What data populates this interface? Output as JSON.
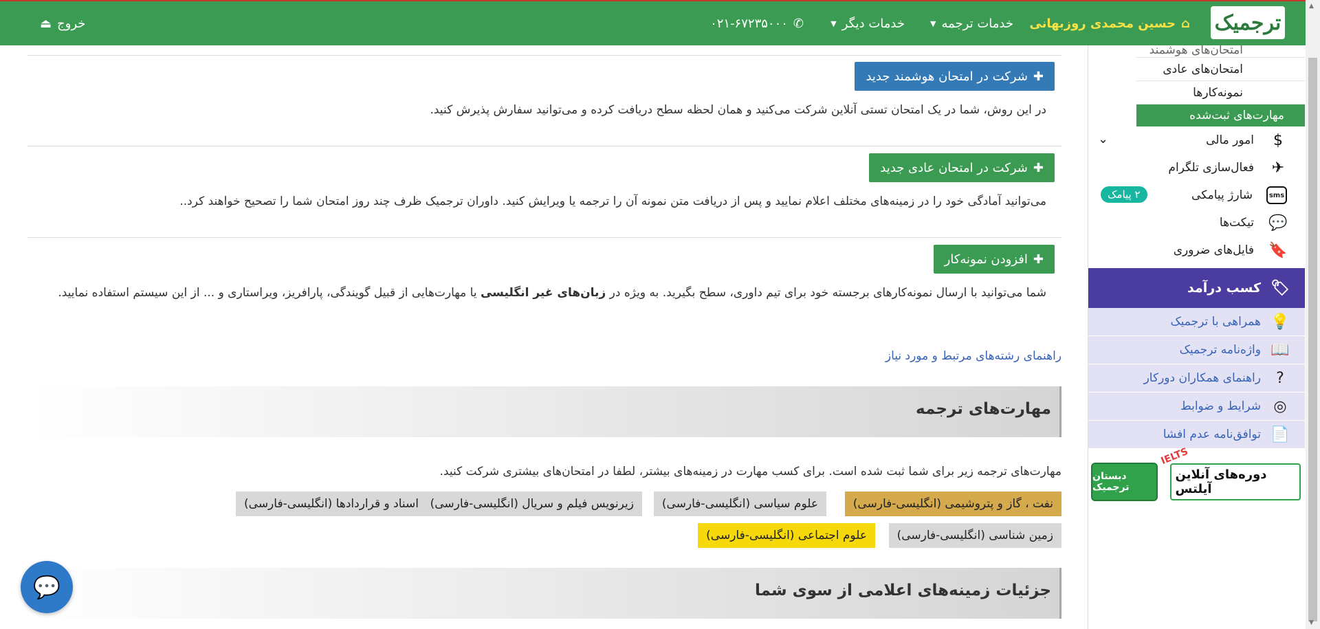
{
  "navbar": {
    "brand": "ترجمیک",
    "user": "حسین محمدی روزبهانی",
    "services": "خدمات ترجمه",
    "other_services": "خدمات دیگر",
    "phone": "۰۲۱-۶۷۲۳۵۰۰۰",
    "logout": "خروج"
  },
  "sidebar": {
    "sub_items": [
      {
        "label": "امتحان‌های هوشمند"
      },
      {
        "label": "امتحان‌های عادی"
      },
      {
        "label": "نمونه‌کارها"
      },
      {
        "label": "مهارت‌های ثبت‌شده"
      }
    ],
    "menu": [
      {
        "label": "امور مالی",
        "icon": "dollar-icon"
      },
      {
        "label": "فعال‌سازی تلگرام",
        "icon": "paper-plane-icon"
      },
      {
        "label": "شارژ پیامکی",
        "icon": "sms-icon",
        "icon_text": "sms",
        "badge": "۲ پیامک"
      },
      {
        "label": "تیکت‌ها",
        "icon": "chat-bubbles-icon"
      },
      {
        "label": "فایل‌های ضروری",
        "icon": "bookmark-icon"
      }
    ],
    "income_header": "کسب درآمد",
    "income_items": [
      {
        "label": "همراهی با ترجمیک",
        "icon": "lightbulb-icon"
      },
      {
        "label": "واژه‌نامه ترجمیک",
        "icon": "dictionary-icon"
      },
      {
        "label": "راهنمای همکاران دورکار",
        "icon": "question-icon"
      },
      {
        "label": "شرایط و ضوابط",
        "icon": "fingerprint-icon"
      },
      {
        "label": "توافق‌نامه عدم افشا",
        "icon": "document-icon"
      }
    ],
    "banner": {
      "logo_text": "دبستان ترجمیک",
      "text": "دوره‌های آنلاین آیلتس",
      "tag": "IELTS"
    }
  },
  "main": {
    "smart_exam_button": "شرکت در امتحان هوشمند جدید",
    "smart_exam_desc": "در این روش، شما در یک امتحان تستی آنلاین شرکت می‌کنید و همان لحظه سطح دریافت کرده و می‌توانید سفارش پذیرش کنید.",
    "normal_exam_button": "شرکت در امتحان عادی جدید",
    "normal_exam_desc": "می‌توانید آمادگی خود را در زمینه‌های مختلف اعلام نمایید و پس از دریافت متن نمونه آن را ترجمه یا ویرایش کنید. داوران ترجمیک ظرف چند روز امتحان شما را تصحیح خواهند کرد..",
    "sample_button": "افزودن نمونه‌کار",
    "sample_desc_1": "شما می‌توانید با ارسال نمونه‌کارهای برجسته خود برای تیم داوری، سطح بگیرید. به ویژه در ",
    "sample_desc_bold": "زبان‌های غیر انگلیسی",
    "sample_desc_2": " یا مهارت‌هایی از قبیل گویندگی، پارافریز، ویراستاری و ... از این سیستم استفاده نمایید.",
    "guide_link": "راهنمای رشته‌های مرتبط و مورد نیاز",
    "skills_title": "مهارت‌های ترجمه",
    "skills_note": "مهارت‌های ترجمه زیر برای شما ثبت شده است. برای کسب مهارت در زمینه‌های بیشتر، لطفا در امتحان‌های بیشتری شرکت کنید.",
    "skills": [
      {
        "label": "نفت ، گاز و پتروشیمی (انگلیسی-فارسی)",
        "color": "#d4aa4d"
      },
      {
        "label": "علوم سیاسی (انگلیسی-فارسی)",
        "color": "#d8d8d8"
      },
      {
        "label": "زیرنویس فیلم و سریال (انگلیسی-فارسی)",
        "color": "#d8d8d8"
      },
      {
        "label": "اسناد و قراردادها (انگلیسی-فارسی)",
        "color": "#d8d8d8"
      },
      {
        "label": "زمین شناسی (انگلیسی-فارسی)",
        "color": "#d8d8d8"
      },
      {
        "label": "علوم اجتماعی (انگلیسی-فارسی)",
        "color": "#f5d90a"
      }
    ],
    "details_title": "جزئیات زمینه‌های اعلامی از سوی شما"
  },
  "colors": {
    "navbar": "#3c9b52",
    "primary_blue": "#337ab7",
    "income_purple": "#4b3d9f",
    "link_blue": "#3764b6"
  }
}
